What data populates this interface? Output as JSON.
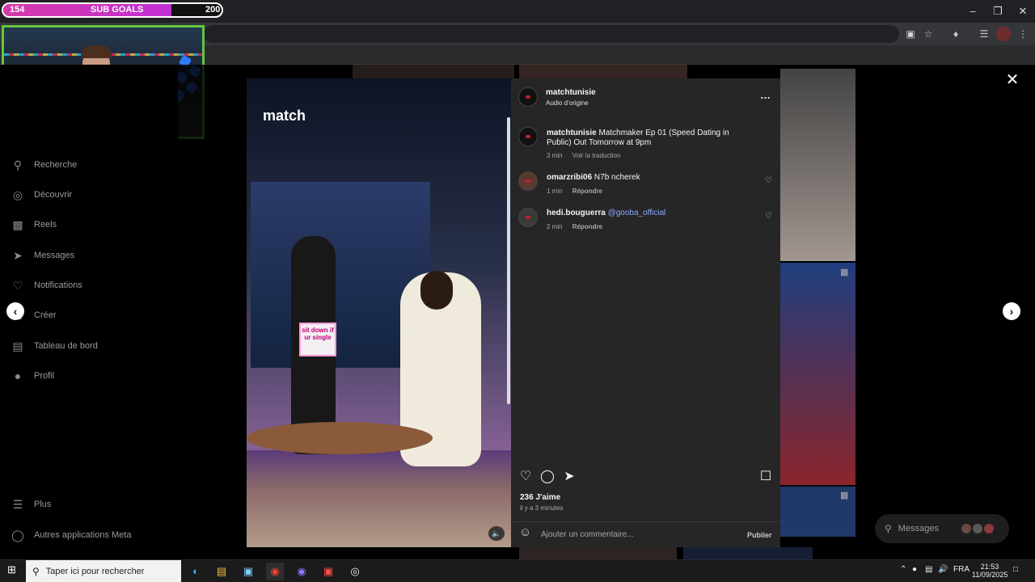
{
  "overlay": {
    "sub_goals": {
      "current": "154",
      "label": "SUB GOALS",
      "goal": "200",
      "progress_fraction": 0.77
    }
  },
  "sidebar": {
    "items": [
      {
        "label": "Recherche",
        "icon": "search-icon"
      },
      {
        "label": "Découvrir",
        "icon": "compass-icon"
      },
      {
        "label": "Reels",
        "icon": "reels-icon"
      },
      {
        "label": "Messages",
        "icon": "send-icon"
      },
      {
        "label": "Notifications",
        "icon": "heart-icon"
      },
      {
        "label": "Créer",
        "icon": "plus-icon"
      },
      {
        "label": "Tableau de bord",
        "icon": "chart-icon"
      },
      {
        "label": "Profil",
        "icon": "avatar-icon"
      }
    ],
    "bottom": [
      {
        "label": "Plus",
        "icon": "menu-icon"
      },
      {
        "label": "Autres applications Meta",
        "icon": "meta-apps-icon"
      }
    ]
  },
  "video": {
    "logo_text": "match",
    "sign_text": "sit down if ur single"
  },
  "post": {
    "author": "matchtunisie",
    "audio": "Audio d'origine",
    "caption": {
      "user": "matchtunisie",
      "text": "Matchmaker Ep 01 (Speed Dating in Public) Out Tomorrow at 9pm",
      "time": "3 min",
      "translate": "Voir la traduction"
    },
    "comments": [
      {
        "user": "omarzribi06",
        "text": "N7b ncherek",
        "mention": "",
        "time": "1 min",
        "reply": "Répondre"
      },
      {
        "user": "hedi.bouguerra",
        "text": "",
        "mention": "@gooba_official",
        "time": "2 min",
        "reply": "Répondre"
      }
    ],
    "likes": "236 J'aime",
    "posted": "il y a 3 minutes",
    "comment_placeholder": "Ajouter un commentaire...",
    "publish": "Publier"
  },
  "messages_pill": {
    "label": "Messages"
  },
  "taskbar": {
    "search_placeholder": "Taper ici pour rechercher",
    "language": "FRA",
    "time": "21:53",
    "date": "11/09/2025"
  },
  "colors": {
    "panel_bg": "#262626",
    "mention": "#8fa9ff",
    "webcam_border": "#63c73f",
    "subgoal_fill": "#c22fd4"
  }
}
